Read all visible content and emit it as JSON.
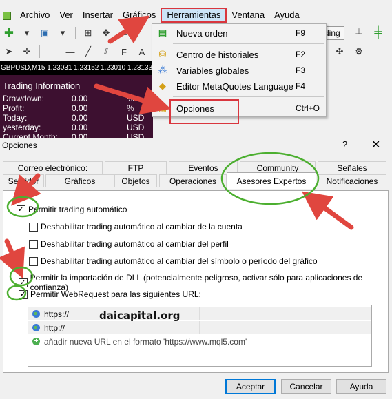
{
  "menubar": {
    "items": [
      "Archivo",
      "Ver",
      "Insertar",
      "Gráficos",
      "Herramientas",
      "Ventana",
      "Ayuda"
    ],
    "active_index": 4
  },
  "toolbar": {
    "trading_label": "ding"
  },
  "chart": {
    "symbol_line": "GBPUSD,M15  1.23031 1.23152 1.23010 1.23133",
    "title": "Trading Information",
    "rows": [
      {
        "label": "Drawdown:",
        "value": "0.00",
        "unit": "%"
      },
      {
        "label": "Profit:",
        "value": "0.00",
        "unit": "%"
      },
      {
        "label": "Today:",
        "value": "0.00",
        "unit": "USD"
      },
      {
        "label": "yesterday:",
        "value": "0.00",
        "unit": "USD"
      },
      {
        "label": "Current Month:",
        "value": "0.00",
        "unit": "USD"
      }
    ]
  },
  "dropdown": {
    "items": [
      {
        "label": "Nueva orden",
        "shortcut": "F9",
        "icon": "new-order-icon"
      },
      {
        "label": "Centro de historiales",
        "shortcut": "F2",
        "icon": "history-center-icon"
      },
      {
        "label": "Variables globales",
        "shortcut": "F3",
        "icon": "global-variables-icon"
      },
      {
        "label": "Editor MetaQuotes Language",
        "shortcut": "F4",
        "icon": "metaeditor-icon"
      },
      {
        "label": "Opciones",
        "shortcut": "Ctrl+O",
        "icon": "options-icon"
      }
    ]
  },
  "dialog": {
    "title": "Opciones",
    "help": "?",
    "close": "✕",
    "tabs_row1": [
      "Correo electrónico:",
      "FTP",
      "Eventos",
      "Community",
      "Señales"
    ],
    "tabs_row2": [
      "Servidor",
      "Gráficos",
      "Objetos",
      "Operaciones",
      "Asesores Expertos",
      "Notificaciones"
    ],
    "selected_tab": "Asesores Expertos",
    "checkboxes": [
      {
        "label": "Permitir trading automático",
        "checked": true
      },
      {
        "label": "Deshabilitar trading automático al cambiar de la cuenta",
        "checked": false
      },
      {
        "label": "Deshabilitar trading automático al cambiar del perfil",
        "checked": false
      },
      {
        "label": "Deshabilitar trading automático al cambiar del símbolo o período del gráfico",
        "checked": false
      },
      {
        "label": "Permitir la importación de DLL (potencialmente peligroso, activar sólo para aplicaciones de confianza)",
        "checked": true
      },
      {
        "label": "Permitir WebRequest para las siguientes URL:",
        "checked": true
      }
    ],
    "urls": [
      {
        "text": "https://"
      },
      {
        "text": "http://"
      },
      {
        "text": "añadir nueva URL en el formato 'https://www.mql5.com'"
      }
    ],
    "watermark": "daicapital.org",
    "buttons": {
      "accept": "Aceptar",
      "cancel": "Cancelar",
      "help": "Ayuda"
    }
  },
  "colors": {
    "annotation_red": "#e0463f",
    "annotation_green": "#4caf30",
    "chart_bg": "#3d1030"
  }
}
